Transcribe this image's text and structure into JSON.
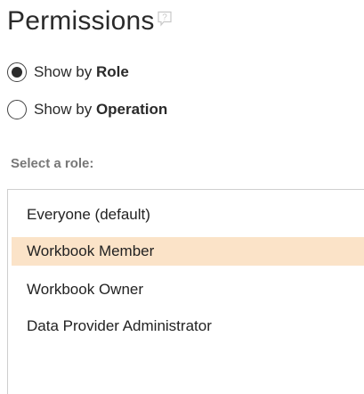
{
  "header": {
    "title": "Permissions",
    "help_icon": "question-bubble-icon"
  },
  "view_mode": {
    "options": [
      {
        "prefix": "Show by ",
        "bold": "Role",
        "selected": true
      },
      {
        "prefix": "Show by ",
        "bold": "Operation",
        "selected": false
      }
    ]
  },
  "role_select": {
    "label": "Select a role:",
    "items": [
      {
        "label": "Everyone (default)",
        "selected": false
      },
      {
        "label": "Workbook Member",
        "selected": true
      },
      {
        "label": "Workbook Owner",
        "selected": false
      },
      {
        "label": "Data Provider Administrator",
        "selected": false
      }
    ]
  },
  "colors": {
    "selected_row": "#fbe3c8",
    "subtle_label": "#777777"
  }
}
